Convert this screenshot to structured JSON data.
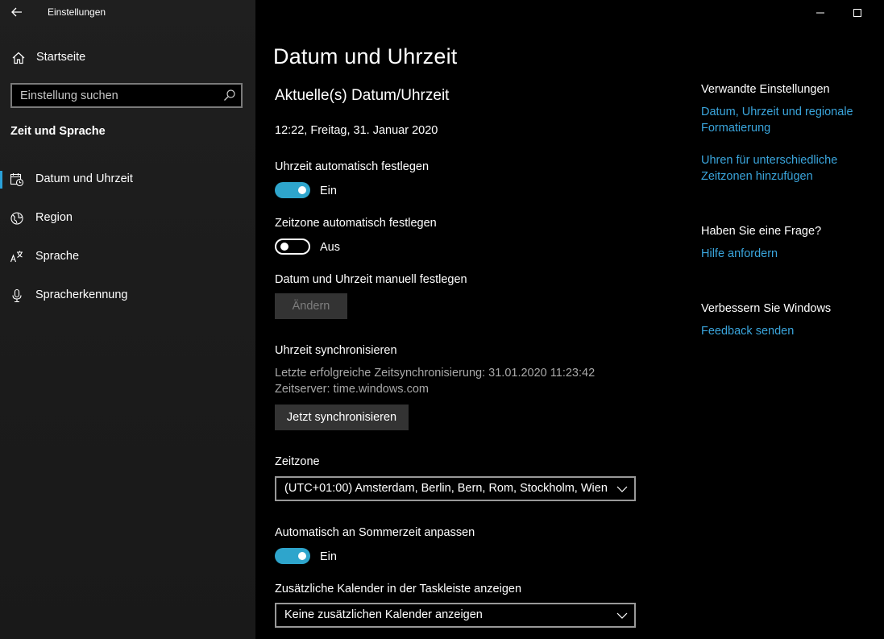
{
  "window": {
    "title": "Einstellungen"
  },
  "sidebar": {
    "home_label": "Startseite",
    "search_placeholder": "Einstellung suchen",
    "section_title": "Zeit und Sprache",
    "items": [
      {
        "label": "Datum und Uhrzeit",
        "icon": "calendar-clock-icon",
        "selected": true
      },
      {
        "label": "Region",
        "icon": "globe-icon",
        "selected": false
      },
      {
        "label": "Sprache",
        "icon": "language-icon",
        "selected": false
      },
      {
        "label": "Spracherkennung",
        "icon": "microphone-icon",
        "selected": false
      }
    ]
  },
  "main": {
    "title": "Datum und Uhrzeit",
    "current_heading": "Aktuelle(s) Datum/Uhrzeit",
    "current_datetime": "12:22, Freitag, 31. Januar 2020",
    "auto_time": {
      "label": "Uhrzeit automatisch festlegen",
      "state": "Ein",
      "on": true
    },
    "auto_timezone": {
      "label": "Zeitzone automatisch festlegen",
      "state": "Aus",
      "on": false
    },
    "manual": {
      "label": "Datum und Uhrzeit manuell festlegen",
      "button": "Ändern"
    },
    "sync": {
      "heading": "Uhrzeit synchronisieren",
      "last_sync": "Letzte erfolgreiche Zeitsynchronisierung: 31.01.2020 11:23:42",
      "server": "Zeitserver: time.windows.com",
      "button": "Jetzt synchronisieren"
    },
    "timezone": {
      "label": "Zeitzone",
      "value": "(UTC+01:00) Amsterdam, Berlin, Bern, Rom, Stockholm, Wien"
    },
    "dst": {
      "label": "Automatisch an Sommerzeit anpassen",
      "state": "Ein",
      "on": true
    },
    "calendar": {
      "label": "Zusätzliche Kalender in der Taskleiste anzeigen",
      "value": "Keine zusätzlichen Kalender anzeigen"
    }
  },
  "related": {
    "heading": "Verwandte Einstellungen",
    "link1": "Datum, Uhrzeit und regionale Formatierung",
    "link2": "Uhren für unterschiedliche Zeitzonen hinzufügen",
    "question_heading": "Haben Sie eine Frage?",
    "help_link": "Hilfe anfordern",
    "improve_heading": "Verbessern Sie Windows",
    "feedback_link": "Feedback senden"
  },
  "colors": {
    "accent": "#2ea5cc",
    "link": "#3aa5dc",
    "sidebar_bg": "#1f1f1f",
    "content_bg": "#000000"
  }
}
